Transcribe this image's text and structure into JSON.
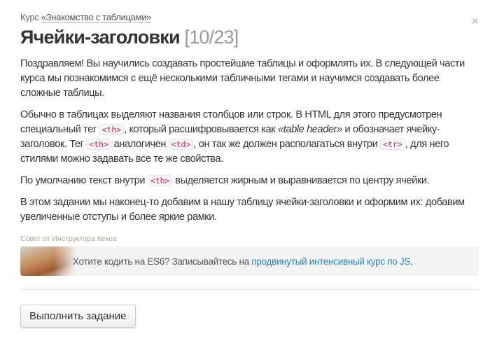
{
  "breadcrumb": {
    "prefix": "Курс ",
    "link": "«Знакомство с таблицами»"
  },
  "title": "Ячейки-заголовки",
  "counter": "[10/23]",
  "close_icon": "×",
  "p1": "Поздравляем! Вы научились создавать простейшие таблицы и оформлять их. В следующей части курса мы познакомимся с ещё несколькими табличными тегами и научимся создавать более сложные таблицы.",
  "p2": {
    "t1": "Обычно в таблицах выделяют названия столбцов или строк. В HTML для этого предусмотрен специальный тег ",
    "c1": "<th>",
    "t2": ", который расшифровывается как ",
    "em": "«table header»",
    "t3": " и обозначает ячейку-заголовок. Тег ",
    "c2": "<th>",
    "t4": " аналогичен ",
    "c3": "<td>",
    "t5": ", он так же должен располагаться внутри ",
    "c4": "<tr>",
    "t6": ", для него стилями можно задавать все те же свойства."
  },
  "p3": {
    "t1": "По умолчанию текст внутри ",
    "c1": "<th>",
    "t2": " выделяется жирным и выравнивается по центру ячейки."
  },
  "p4": "В этом задании мы наконец-то добавим в нашу таблицу ячейки-заголовки и оформим их: добавим увеличенные отступы и более яркие рамки.",
  "tip": {
    "label": "Совет от Инструктора Кекса",
    "text": "Хотите кодить на ES6? Записывайтесь на ",
    "link": "продвинутый интенсивный курс по JS",
    "end": "."
  },
  "submit_label": "Выполнить задание"
}
